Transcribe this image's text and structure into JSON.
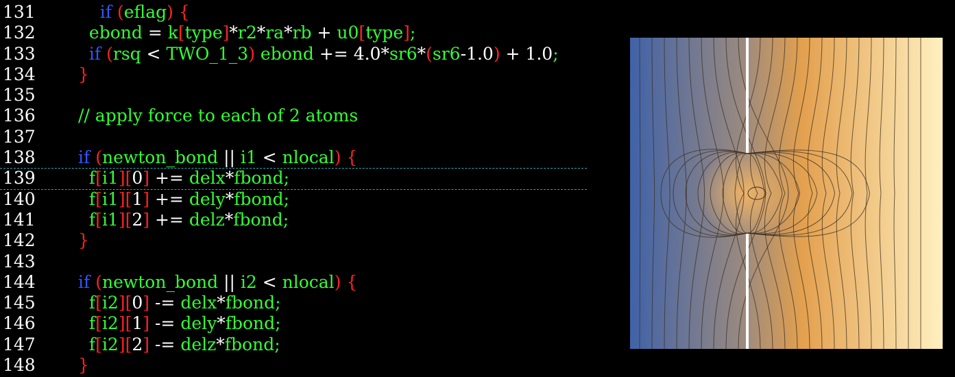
{
  "editor": {
    "highlight_color": "#2aa8b5",
    "lines": [
      {
        "num": "131",
        "tokens": [
          {
            "t": "    ",
            "c": "pl"
          },
          {
            "t": "if",
            "c": "kw"
          },
          {
            "t": " ",
            "c": "pl"
          },
          {
            "t": "(",
            "c": "br"
          },
          {
            "t": "eflag",
            "c": "id"
          },
          {
            "t": ")",
            "c": "br"
          },
          {
            "t": " ",
            "c": "pl"
          },
          {
            "t": "{",
            "c": "br"
          }
        ]
      },
      {
        "num": "132",
        "tokens": [
          {
            "t": "  ",
            "c": "pl"
          },
          {
            "t": "ebond",
            "c": "id"
          },
          {
            "t": " = ",
            "c": "op"
          },
          {
            "t": "k",
            "c": "id"
          },
          {
            "t": "[",
            "c": "br"
          },
          {
            "t": "type",
            "c": "id"
          },
          {
            "t": "]",
            "c": "br"
          },
          {
            "t": "*",
            "c": "op"
          },
          {
            "t": "r2",
            "c": "id"
          },
          {
            "t": "*",
            "c": "op"
          },
          {
            "t": "ra",
            "c": "id"
          },
          {
            "t": "*",
            "c": "op"
          },
          {
            "t": "rb",
            "c": "id"
          },
          {
            "t": " + ",
            "c": "op"
          },
          {
            "t": "u0",
            "c": "id"
          },
          {
            "t": "[",
            "c": "br"
          },
          {
            "t": "type",
            "c": "id"
          },
          {
            "t": "]",
            "c": "br"
          },
          {
            "t": ";",
            "c": "id"
          }
        ]
      },
      {
        "num": "133",
        "tokens": [
          {
            "t": "  ",
            "c": "pl"
          },
          {
            "t": "if",
            "c": "kw"
          },
          {
            "t": " ",
            "c": "pl"
          },
          {
            "t": "(",
            "c": "br"
          },
          {
            "t": "rsq",
            "c": "id"
          },
          {
            "t": " < ",
            "c": "op"
          },
          {
            "t": "TWO_1_3",
            "c": "id"
          },
          {
            "t": ")",
            "c": "br"
          },
          {
            "t": " ",
            "c": "pl"
          },
          {
            "t": "ebond",
            "c": "id"
          },
          {
            "t": " += ",
            "c": "op"
          },
          {
            "t": "4.0",
            "c": "op"
          },
          {
            "t": "*",
            "c": "op"
          },
          {
            "t": "sr6",
            "c": "id"
          },
          {
            "t": "*",
            "c": "op"
          },
          {
            "t": "(",
            "c": "br"
          },
          {
            "t": "sr6",
            "c": "id"
          },
          {
            "t": "-1.0",
            "c": "op"
          },
          {
            "t": ")",
            "c": "br"
          },
          {
            "t": " + 1.0",
            "c": "op"
          },
          {
            "t": ";",
            "c": "id"
          }
        ]
      },
      {
        "num": "134",
        "tokens": [
          {
            "t": "}",
            "c": "br"
          }
        ]
      },
      {
        "num": "135",
        "tokens": []
      },
      {
        "num": "136",
        "tokens": [
          {
            "t": "// apply force to each of 2 atoms",
            "c": "cm"
          }
        ]
      },
      {
        "num": "137",
        "tokens": []
      },
      {
        "num": "138",
        "tokens": [
          {
            "t": "if",
            "c": "kw"
          },
          {
            "t": " ",
            "c": "pl"
          },
          {
            "t": "(",
            "c": "br"
          },
          {
            "t": "newton_bond",
            "c": "id"
          },
          {
            "t": " || ",
            "c": "op"
          },
          {
            "t": "i1",
            "c": "id"
          },
          {
            "t": " < ",
            "c": "op"
          },
          {
            "t": "nlocal",
            "c": "id"
          },
          {
            "t": ")",
            "c": "br"
          },
          {
            "t": " ",
            "c": "pl"
          },
          {
            "t": "{",
            "c": "br"
          }
        ]
      },
      {
        "num": "139",
        "tokens": [
          {
            "t": "  ",
            "c": "pl"
          },
          {
            "t": "f",
            "c": "id"
          },
          {
            "t": "[",
            "c": "br"
          },
          {
            "t": "i1",
            "c": "id"
          },
          {
            "t": "][",
            "c": "br"
          },
          {
            "t": "0",
            "c": "op"
          },
          {
            "t": "]",
            "c": "br"
          },
          {
            "t": " += ",
            "c": "op"
          },
          {
            "t": "delx",
            "c": "id"
          },
          {
            "t": "*",
            "c": "op"
          },
          {
            "t": "fbond",
            "c": "id"
          },
          {
            "t": ";",
            "c": "id"
          }
        ]
      },
      {
        "num": "140",
        "tokens": [
          {
            "t": "  ",
            "c": "pl"
          },
          {
            "t": "f",
            "c": "id"
          },
          {
            "t": "[",
            "c": "br"
          },
          {
            "t": "i1",
            "c": "id"
          },
          {
            "t": "][",
            "c": "br"
          },
          {
            "t": "1",
            "c": "op"
          },
          {
            "t": "]",
            "c": "br"
          },
          {
            "t": " += ",
            "c": "op"
          },
          {
            "t": "dely",
            "c": "id"
          },
          {
            "t": "*",
            "c": "op"
          },
          {
            "t": "fbond",
            "c": "id"
          },
          {
            "t": ";",
            "c": "id"
          }
        ]
      },
      {
        "num": "141",
        "tokens": [
          {
            "t": "  ",
            "c": "pl"
          },
          {
            "t": "f",
            "c": "id"
          },
          {
            "t": "[",
            "c": "br"
          },
          {
            "t": "i1",
            "c": "id"
          },
          {
            "t": "][",
            "c": "br"
          },
          {
            "t": "2",
            "c": "op"
          },
          {
            "t": "]",
            "c": "br"
          },
          {
            "t": " += ",
            "c": "op"
          },
          {
            "t": "delz",
            "c": "id"
          },
          {
            "t": "*",
            "c": "op"
          },
          {
            "t": "fbond",
            "c": "id"
          },
          {
            "t": ";",
            "c": "id"
          }
        ]
      },
      {
        "num": "142",
        "tokens": [
          {
            "t": "}",
            "c": "br"
          }
        ]
      },
      {
        "num": "143",
        "tokens": []
      },
      {
        "num": "144",
        "tokens": [
          {
            "t": "if",
            "c": "kw"
          },
          {
            "t": " ",
            "c": "pl"
          },
          {
            "t": "(",
            "c": "br"
          },
          {
            "t": "newton_bond",
            "c": "id"
          },
          {
            "t": " || ",
            "c": "op"
          },
          {
            "t": "i2",
            "c": "id"
          },
          {
            "t": " < ",
            "c": "op"
          },
          {
            "t": "nlocal",
            "c": "id"
          },
          {
            "t": ")",
            "c": "br"
          },
          {
            "t": " ",
            "c": "pl"
          },
          {
            "t": "{",
            "c": "br"
          }
        ]
      },
      {
        "num": "145",
        "tokens": [
          {
            "t": "  ",
            "c": "pl"
          },
          {
            "t": "f",
            "c": "id"
          },
          {
            "t": "[",
            "c": "br"
          },
          {
            "t": "i2",
            "c": "id"
          },
          {
            "t": "][",
            "c": "br"
          },
          {
            "t": "0",
            "c": "op"
          },
          {
            "t": "]",
            "c": "br"
          },
          {
            "t": " -= ",
            "c": "op"
          },
          {
            "t": "delx",
            "c": "id"
          },
          {
            "t": "*",
            "c": "op"
          },
          {
            "t": "fbond",
            "c": "id"
          },
          {
            "t": ";",
            "c": "id"
          }
        ]
      },
      {
        "num": "146",
        "tokens": [
          {
            "t": "  ",
            "c": "pl"
          },
          {
            "t": "f",
            "c": "id"
          },
          {
            "t": "[",
            "c": "br"
          },
          {
            "t": "i2",
            "c": "id"
          },
          {
            "t": "][",
            "c": "br"
          },
          {
            "t": "1",
            "c": "op"
          },
          {
            "t": "]",
            "c": "br"
          },
          {
            "t": " -= ",
            "c": "op"
          },
          {
            "t": "dely",
            "c": "id"
          },
          {
            "t": "*",
            "c": "op"
          },
          {
            "t": "fbond",
            "c": "id"
          },
          {
            "t": ";",
            "c": "id"
          }
        ]
      },
      {
        "num": "147",
        "tokens": [
          {
            "t": "  ",
            "c": "pl"
          },
          {
            "t": "f",
            "c": "id"
          },
          {
            "t": "[",
            "c": "br"
          },
          {
            "t": "i2",
            "c": "id"
          },
          {
            "t": "][",
            "c": "br"
          },
          {
            "t": "2",
            "c": "op"
          },
          {
            "t": "]",
            "c": "br"
          },
          {
            "t": " -= ",
            "c": "op"
          },
          {
            "t": "delz",
            "c": "id"
          },
          {
            "t": "*",
            "c": "op"
          },
          {
            "t": "fbond",
            "c": "id"
          },
          {
            "t": ";",
            "c": "id"
          }
        ]
      },
      {
        "num": "148",
        "tokens": [
          {
            "t": "}",
            "c": "br"
          }
        ]
      }
    ]
  },
  "contour_figure": {
    "colors": {
      "left": "#3f62a8",
      "mid": "#9a8a80",
      "warm": "#e3a04e",
      "right": "#fff0c0",
      "line": "#3a2e22",
      "barrier": "#ffffff"
    }
  }
}
